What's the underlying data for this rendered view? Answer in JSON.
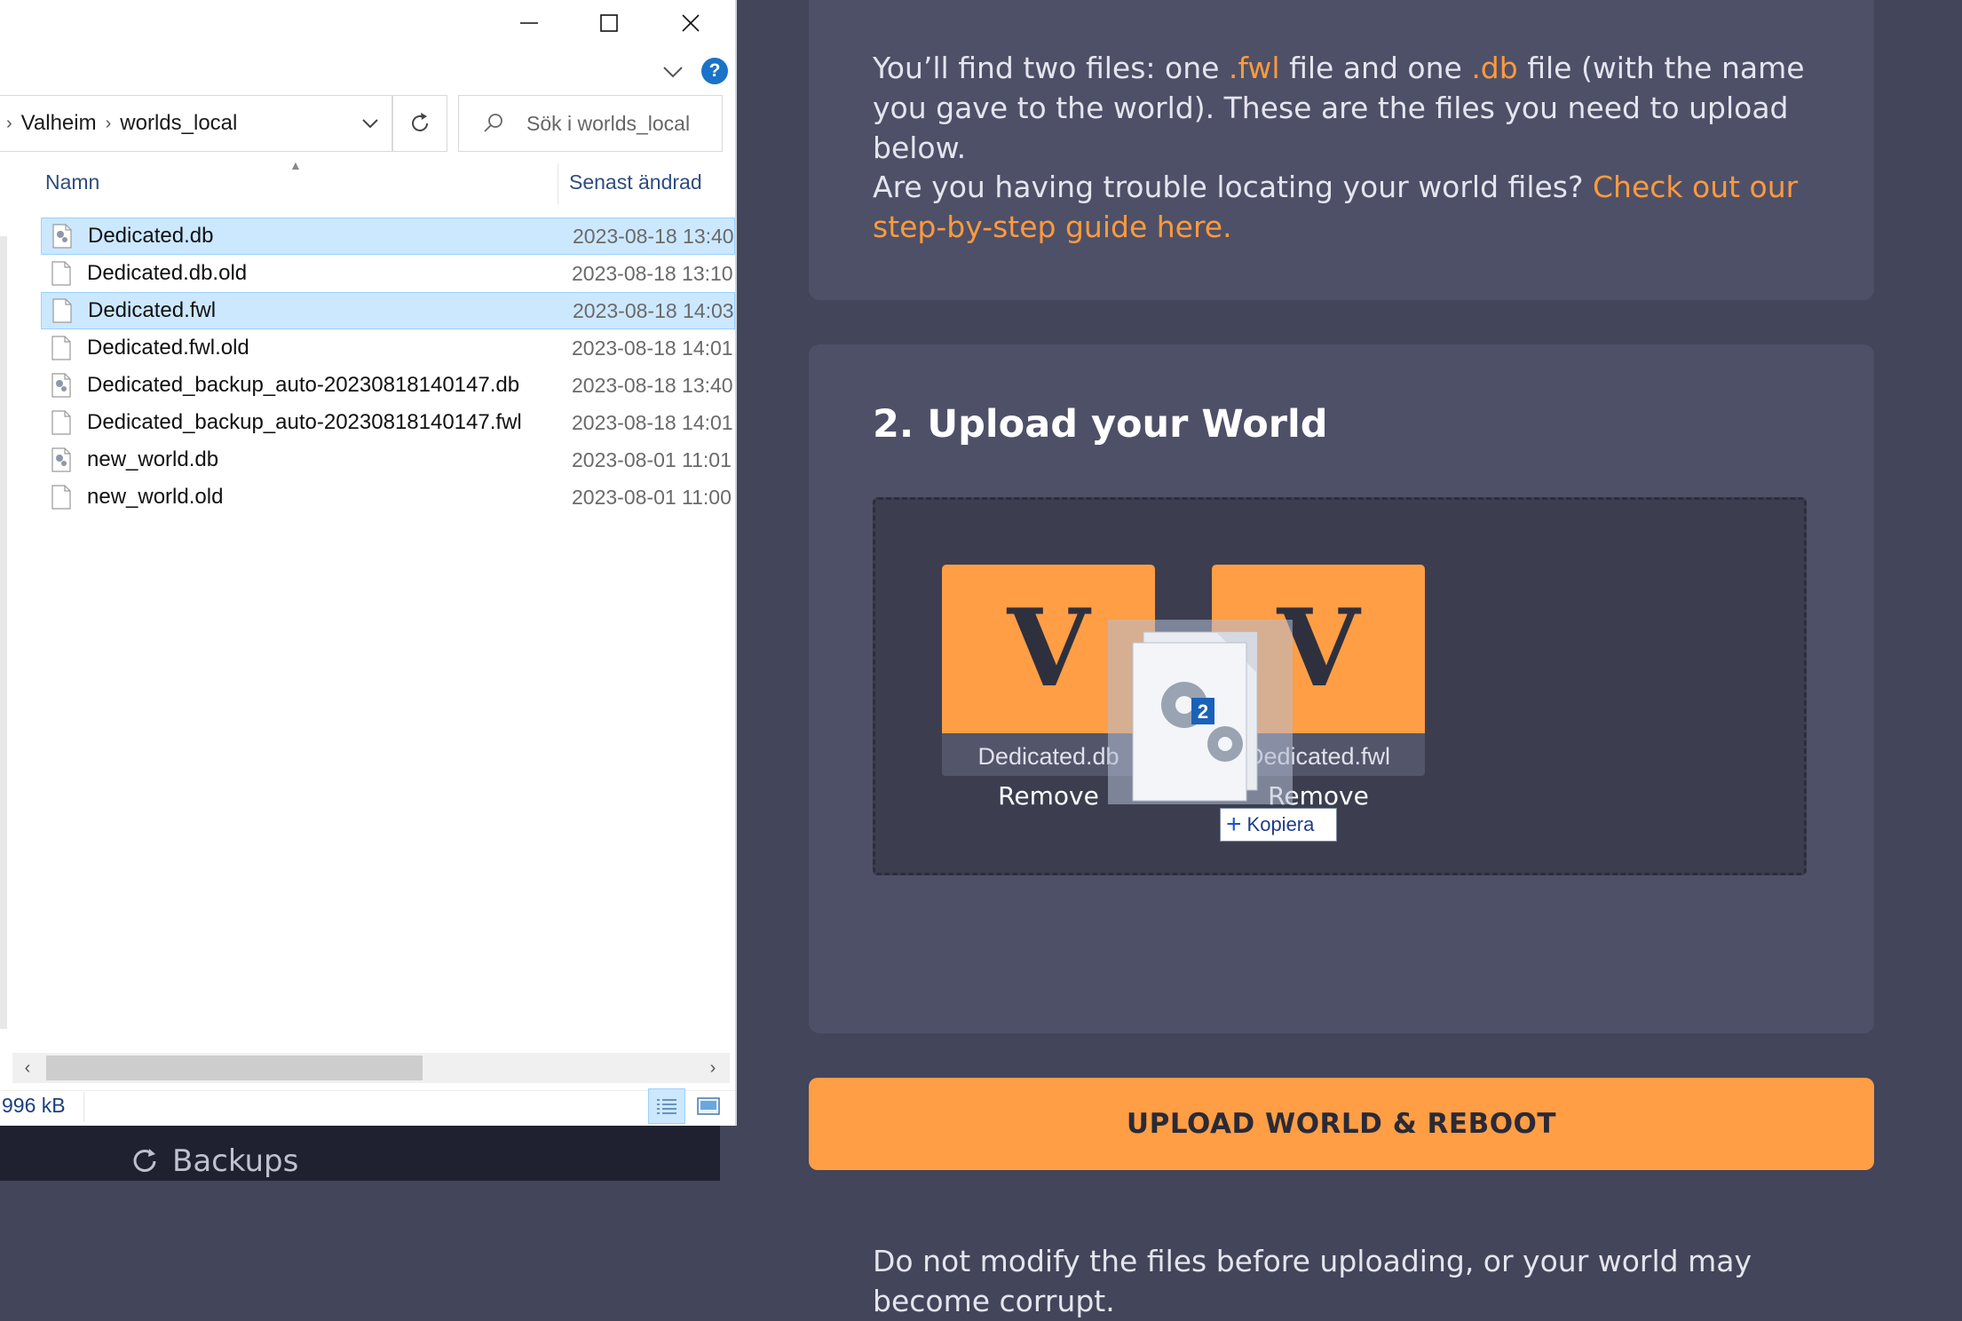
{
  "web": {
    "card1": {
      "para1_pre": "You’ll find two files: one ",
      "ext_fwl": ".fwl",
      "para1_mid": " file and one ",
      "ext_db": ".db",
      "para1_post": " file (with the name you gave to the world). These are the files you need to upload below.",
      "para2_pre": "Are you having trouble locating your world files? ",
      "para2_link": "Check out our step-by-step guide here."
    },
    "card2": {
      "heading": "2. Upload your World",
      "files": [
        {
          "letter": "V",
          "name": "Dedicated.db",
          "remove": "Remove"
        },
        {
          "letter": "V",
          "name": "Dedicated.fwl",
          "remove": "Remove"
        }
      ],
      "drag_badge_count": "2",
      "drag_action": "Kopiera",
      "note": "Do not modify the files before uploading, or your world may become corrupt."
    },
    "upload_button": "UPLOAD WORLD & REBOOT",
    "sidebar_backups": "Backups"
  },
  "explorer": {
    "breadcrumb": [
      "Valheim",
      "worlds_local"
    ],
    "search_placeholder": "Sök i worlds_local",
    "columns": {
      "name": "Namn",
      "modified": "Senast ändrad"
    },
    "files": [
      {
        "name": "Dedicated.db",
        "date": "2023-08-18 13:40",
        "icon": "db-file-icon",
        "selected": true
      },
      {
        "name": "Dedicated.db.old",
        "date": "2023-08-18 13:10",
        "icon": "blank-file-icon",
        "selected": false
      },
      {
        "name": "Dedicated.fwl",
        "date": "2023-08-18 14:03",
        "icon": "blank-file-icon",
        "selected": true
      },
      {
        "name": "Dedicated.fwl.old",
        "date": "2023-08-18 14:01",
        "icon": "blank-file-icon",
        "selected": false
      },
      {
        "name": "Dedicated_backup_auto-20230818140147.db",
        "date": "2023-08-18 13:40",
        "icon": "db-file-icon",
        "selected": false
      },
      {
        "name": "Dedicated_backup_auto-20230818140147.fwl",
        "date": "2023-08-18 14:01",
        "icon": "blank-file-icon",
        "selected": false
      },
      {
        "name": "new_world.db",
        "date": "2023-08-01 11:01",
        "icon": "db-file-icon",
        "selected": false
      },
      {
        "name": "new_world.old",
        "date": "2023-08-01 11:00",
        "icon": "blank-file-icon",
        "selected": false
      }
    ],
    "status_size": "996 kB",
    "colors": {
      "selection": "#cce8ff",
      "accent": "#ff9e45",
      "help": "#1a73c8"
    }
  }
}
